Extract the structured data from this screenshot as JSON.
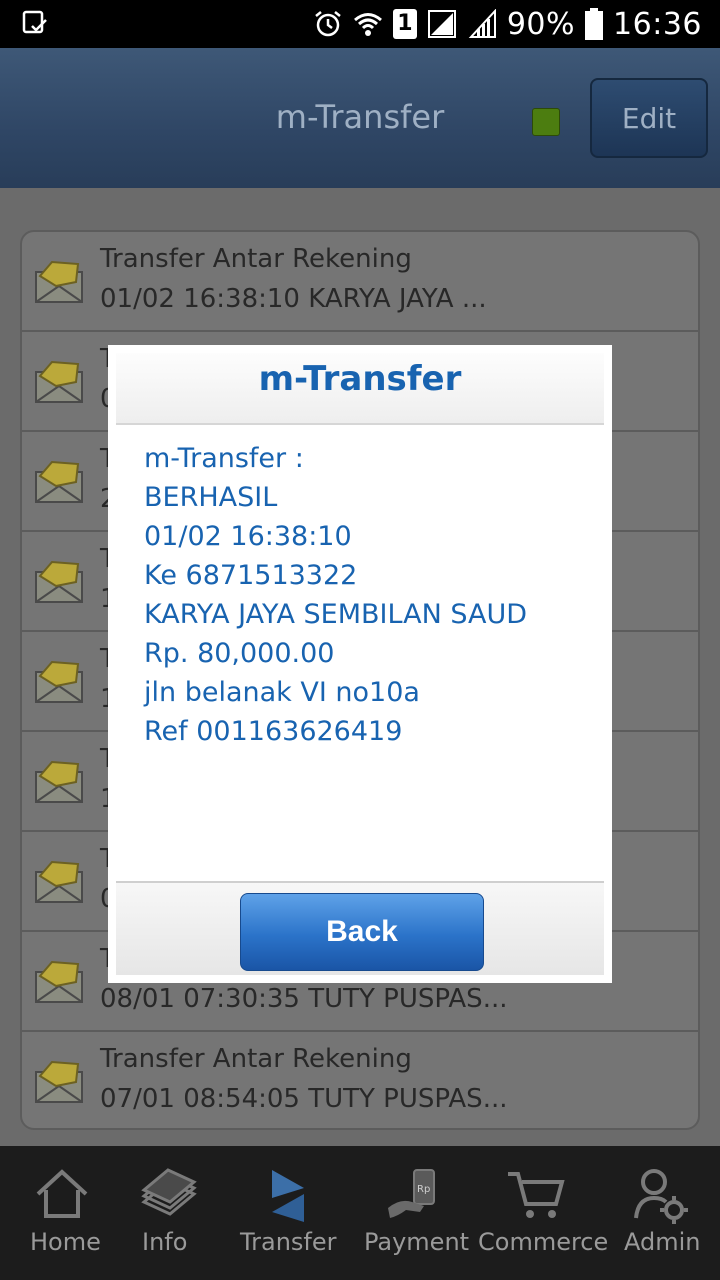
{
  "status_bar": {
    "sim_label": "1",
    "battery": "90%",
    "time": "16:36",
    "icons": [
      "screenshot-icon",
      "alarm-icon",
      "wifi-icon",
      "sim-icon",
      "signal-icon",
      "battery-icon"
    ]
  },
  "app_bar": {
    "title": "m-Transfer",
    "edit_label": "Edit",
    "indicator_color": "#4c7d10"
  },
  "list": {
    "items": [
      {
        "title": "Transfer Antar Rekening",
        "subtitle": "01/02 16:38:10 KARYA JAYA ..."
      },
      {
        "title": "T",
        "subtitle": "0"
      },
      {
        "title": "T",
        "subtitle": "2"
      },
      {
        "title": "T",
        "subtitle": "1"
      },
      {
        "title": "T",
        "subtitle": "1"
      },
      {
        "title": "T",
        "subtitle": "1"
      },
      {
        "title": "T",
        "subtitle": "0"
      },
      {
        "title": "T",
        "subtitle": "08/01 07:30:35 TUTY PUSPAS..."
      },
      {
        "title": "Transfer Antar Rekening",
        "subtitle": "07/01 08:54:05 TUTY PUSPAS..."
      }
    ]
  },
  "dialog": {
    "title": "m-Transfer",
    "lines": [
      "m-Transfer :",
      "BERHASIL",
      "01/02 16:38:10",
      "Ke 6871513322",
      "KARYA JAYA SEMBILAN SAUD",
      "Rp. 80,000.00",
      "jln belanak VI no10a",
      "Ref 001163626419"
    ],
    "back_label": "Back"
  },
  "bottom_nav": {
    "items": [
      {
        "label": "Home",
        "icon": "home-icon"
      },
      {
        "label": "Info",
        "icon": "info-icon"
      },
      {
        "label": "Transfer",
        "icon": "transfer-icon"
      },
      {
        "label": "Payment",
        "icon": "payment-icon"
      },
      {
        "label": "Commerce",
        "icon": "cart-icon"
      },
      {
        "label": "Admin",
        "icon": "admin-icon"
      }
    ]
  },
  "colors": {
    "accent": "#1863b0",
    "app_bar": "#2f4665",
    "back_button": "#2b73c9"
  }
}
